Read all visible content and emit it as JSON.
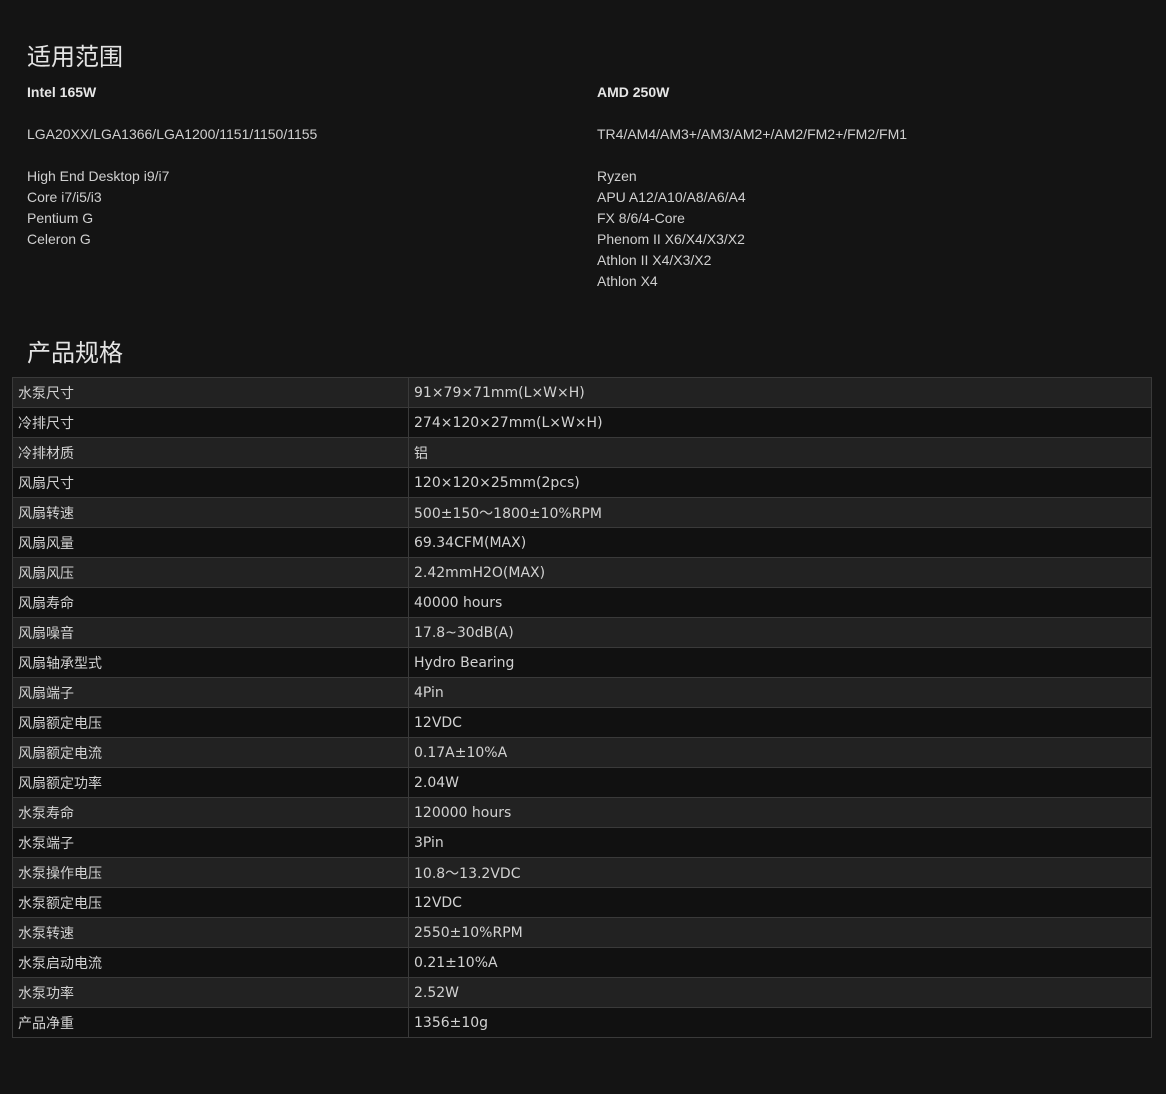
{
  "compat": {
    "title": "适用范围",
    "intel": {
      "brand": "Intel 165W",
      "sockets": "LGA20XX/LGA1366/LGA1200/1151/1150/1155",
      "models": [
        "High End Desktop i9/i7",
        "Core i7/i5/i3",
        "Pentium G",
        "Celeron G"
      ]
    },
    "amd": {
      "brand": "AMD 250W",
      "sockets": "TR4/AM4/AM3+/AM3/AM2+/AM2/FM2+/FM2/FM1",
      "models": [
        "Ryzen",
        "APU A12/A10/A8/A6/A4",
        "FX 8/6/4-Core",
        "Phenom II X6/X4/X3/X2",
        "Athlon II X4/X3/X2",
        "Athlon X4"
      ]
    }
  },
  "specs": {
    "title": "产品规格",
    "rows": [
      {
        "label": "水泵尺寸",
        "value": "91×79×71mm(L×W×H)"
      },
      {
        "label": "冷排尺寸",
        "value": "274×120×27mm(L×W×H)"
      },
      {
        "label": "冷排材质",
        "value": "铝"
      },
      {
        "label": "风扇尺寸",
        "value": "120×120×25mm(2pcs)"
      },
      {
        "label": "风扇转速",
        "value": "500±150～1800±10%RPM"
      },
      {
        "label": "风扇风量",
        "value": "69.34CFM(MAX)"
      },
      {
        "label": "风扇风压",
        "value": "2.42mmH2O(MAX)"
      },
      {
        "label": "风扇寿命",
        "value": "40000 hours"
      },
      {
        "label": "风扇噪音",
        "value": "17.8~30dB(A)"
      },
      {
        "label": "风扇轴承型式",
        "value": "Hydro Bearing"
      },
      {
        "label": "风扇端子",
        "value": "4Pin"
      },
      {
        "label": "风扇额定电压",
        "value": "12VDC"
      },
      {
        "label": "风扇额定电流",
        "value": "0.17A±10%A"
      },
      {
        "label": "风扇额定功率",
        "value": "2.04W"
      },
      {
        "label": "水泵寿命",
        "value": "120000 hours"
      },
      {
        "label": "水泵端子",
        "value": "3Pin"
      },
      {
        "label": "水泵操作电压",
        "value": "10.8～13.2VDC"
      },
      {
        "label": "水泵额定电压",
        "value": "12VDC"
      },
      {
        "label": "水泵转速",
        "value": "2550±10%RPM"
      },
      {
        "label": "水泵启动电流",
        "value": "0.21±10%A"
      },
      {
        "label": "水泵功率",
        "value": "2.52W"
      },
      {
        "label": "产品净重",
        "value": "1356±10g"
      }
    ]
  }
}
